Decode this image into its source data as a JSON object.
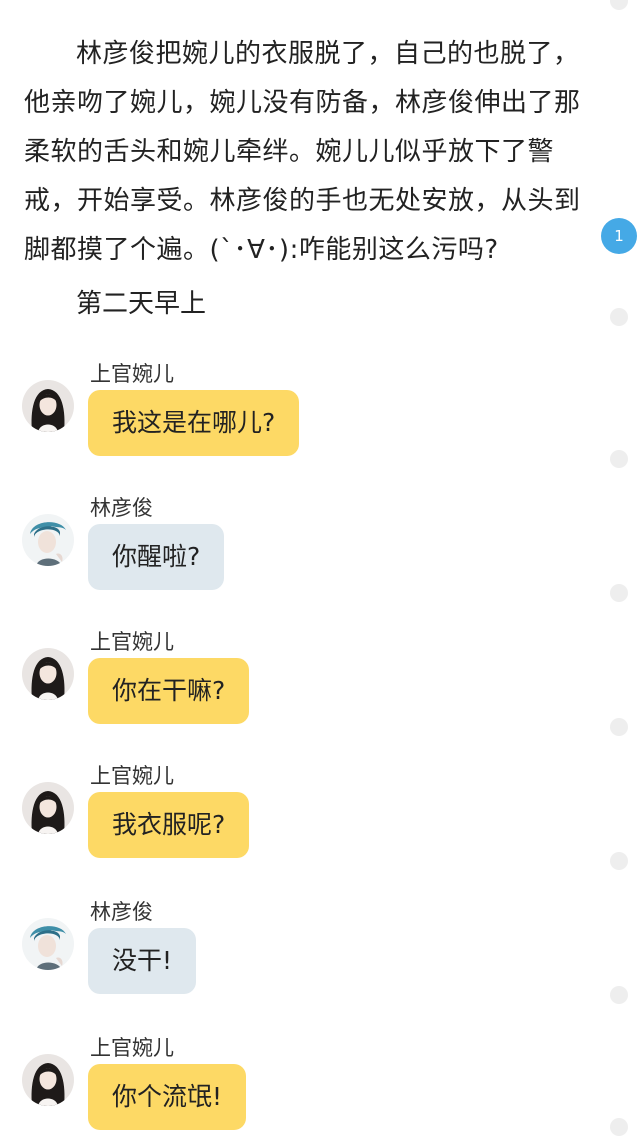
{
  "narration": "林彦俊把婉儿的衣服脱了，自己的也脱了，他亲吻了婉儿，婉儿没有防备，林彦俊伸出了那柔软的舌头和婉儿牵绊。婉儿儿似乎放下了警戒，开始享受。林彦俊的手也无处安放，从头到脚都摸了个遍。(`･∀･):咋能别这么污吗?",
  "scene_title": "第二天早上",
  "comment_badge_count": "1",
  "colors": {
    "yellow_bubble": "#fdd965",
    "blue_bubble": "#dfe8ee",
    "badge": "#45a9e6"
  },
  "messages": [
    {
      "sender": "上官婉儿",
      "text": "我这是在哪儿?",
      "style": "yellow",
      "avatar": "girl-avatar"
    },
    {
      "sender": "林彦俊",
      "text": "你醒啦?",
      "style": "blue",
      "avatar": "boy-avatar"
    },
    {
      "sender": "上官婉儿",
      "text": "你在干嘛?",
      "style": "yellow",
      "avatar": "girl-avatar"
    },
    {
      "sender": "上官婉儿",
      "text": "我衣服呢?",
      "style": "yellow",
      "avatar": "girl-avatar"
    },
    {
      "sender": "林彦俊",
      "text": "没干!",
      "style": "blue",
      "avatar": "boy-avatar"
    },
    {
      "sender": "上官婉儿",
      "text": "你个流氓!",
      "style": "yellow",
      "avatar": "girl-avatar"
    }
  ]
}
